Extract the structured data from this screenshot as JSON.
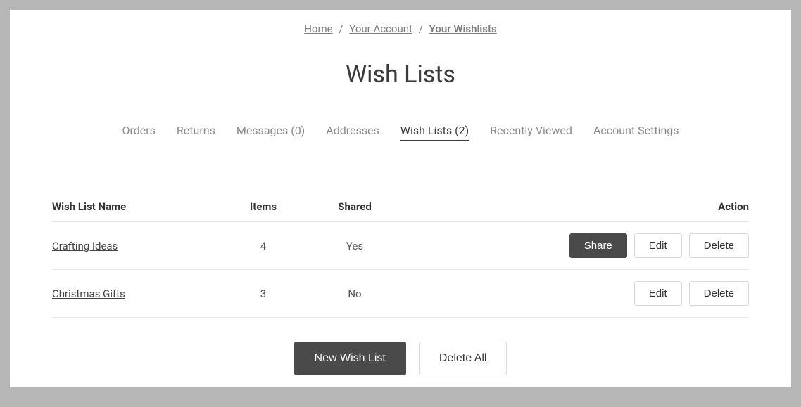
{
  "breadcrumb": {
    "home": "Home",
    "account": "Your Account",
    "current": "Your Wishlists"
  },
  "title": "Wish Lists",
  "tabs": {
    "orders": "Orders",
    "returns": "Returns",
    "messages": "Messages (0)",
    "addresses": "Addresses",
    "wishlists": "Wish Lists (2)",
    "recent": "Recently Viewed",
    "settings": "Account Settings"
  },
  "table": {
    "headers": {
      "name": "Wish List Name",
      "items": "Items",
      "shared": "Shared",
      "action": "Action"
    },
    "rows": [
      {
        "name": "Crafting Ideas",
        "items": "4",
        "shared": "Yes",
        "share": true
      },
      {
        "name": "Christmas Gifts",
        "items": "3",
        "shared": "No",
        "share": false
      }
    ]
  },
  "buttons": {
    "share": "Share",
    "edit": "Edit",
    "delete": "Delete",
    "new": "New Wish List",
    "deleteAll": "Delete All"
  }
}
